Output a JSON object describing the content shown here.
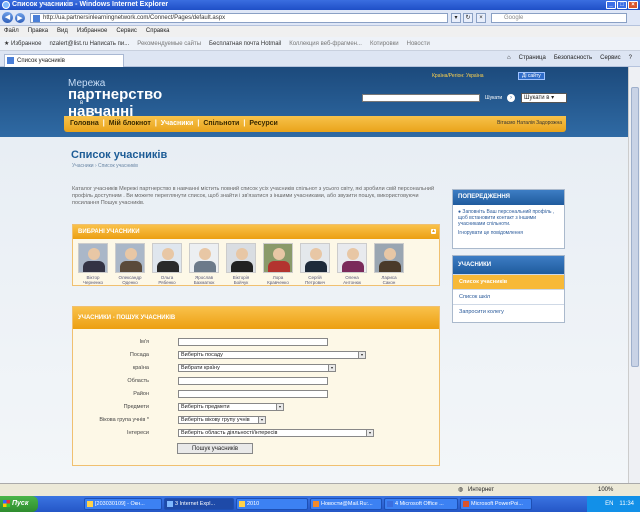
{
  "window": {
    "title": "Список учасників - Windows Internet Explorer"
  },
  "address": {
    "url": "http://ua.partnersinlearningnetwork.com/Connect/Pages/default.aspx",
    "search_placeholder": "Google"
  },
  "menu": [
    "Файл",
    "Правка",
    "Вид",
    "Избранное",
    "Сервис",
    "Справка"
  ],
  "favorites": {
    "label": "Избранное",
    "items": [
      {
        "label": "nzalert@list.ru Написать пи..."
      },
      {
        "label": "Рекомендуемые сайты"
      },
      {
        "label": "Бесплатная почта Hotmail"
      },
      {
        "label": "Коллекция веб-фрагмен..."
      },
      {
        "label": "Котировки"
      },
      {
        "label": "Новости"
      }
    ]
  },
  "tab": {
    "label": "Список учасників"
  },
  "tools": [
    "Страница",
    "Безопасность",
    "Сервис"
  ],
  "site": {
    "logo_line1": "Мережа",
    "logo_line2": "партнерство",
    "logo_line3": "в",
    "logo_line4": "навчанні",
    "country_label": "Країна/Регіон: Україна",
    "country_button": "Ді сайту",
    "search_label": "Шукати",
    "search_scope": "Шукати в",
    "nav": [
      {
        "label": "Головна"
      },
      {
        "label": "Мій блокнот"
      },
      {
        "label": "Учасники"
      },
      {
        "label": "Спільноти"
      },
      {
        "label": "Ресурси"
      }
    ],
    "welcome": "Вітаємо Наталія Задорожна"
  },
  "main": {
    "title": "Список учасників",
    "breadcrumb": "Учасники › Список учасників",
    "intro": "Каталог учасників Мережі партнерство в навчанні містить повний список усіх учасників спільнот з усього світу, які зробили свій персональний профіль доступним . Ви можете переглянути список, щоб знайти і зв'язатися з іншими учасниками, або звузити пошук, використовуючи посилання Пошук учасників.",
    "featured_title": "ВИБРАНІ УЧАСНИКИ",
    "members": [
      {
        "first": "Віктор",
        "last": "Черненко"
      },
      {
        "first": "Олександр",
        "last": "Оденко"
      },
      {
        "first": "Ольга",
        "last": "Рябенко"
      },
      {
        "first": "Ярослав",
        "last": "Бахматюк"
      },
      {
        "first": "Вікторія",
        "last": "Бойчук"
      },
      {
        "first": "Лора",
        "last": "Кравченко"
      },
      {
        "first": "Сергій",
        "last": "Петрович"
      },
      {
        "first": "Олена",
        "last": "Антонюк"
      },
      {
        "first": "Лариса",
        "last": "Сакон"
      }
    ],
    "search_title": "УЧАСНИКИ - ПОШУК УЧАСНИКІВ",
    "form": {
      "name_label": "Ім'я",
      "position_label": "Посада",
      "position_value": "Виберіть посаду",
      "country_label": "країна",
      "country_value": "Вибрати країну",
      "region_label": "Область",
      "district_label": "Район",
      "subjects_label": "Предмети",
      "subjects_value": "Виберіть предмети",
      "age_label": "Вікова група учнів *",
      "age_value": "Виберіть вікову групу учнів",
      "interests_label": "Інтереси",
      "interests_value": "Виберіть область діяльності/інтересів",
      "submit": "Пошук учасників"
    }
  },
  "sidebar": {
    "warning_title": "ПОПЕРЕДЖЕННЯ",
    "warning_text": "Заповніть Ваш персональний профіль , щоб встановити контакт з іншими учасниками спільноти.",
    "warning_link": "Ігнорувати це повідомлення",
    "members_title": "УЧАСНИКИ",
    "links": [
      {
        "label": "Список учасників"
      },
      {
        "label": "Список шкіл"
      },
      {
        "label": "Запросити колегу"
      }
    ]
  },
  "status": {
    "zone": "Интернет",
    "zoom": "100%"
  },
  "taskbar": {
    "start": "Пуск",
    "items": [
      {
        "label": "[203030109] - Окн..."
      },
      {
        "label": "3 Internet Expl..."
      },
      {
        "label": "2010"
      },
      {
        "label": "Новости@Mail.Ru:..."
      },
      {
        "label": "4 Microsoft Office ..."
      },
      {
        "label": "Microsoft PowerPoi..."
      }
    ],
    "lang": "EN",
    "clock": "11:34"
  }
}
